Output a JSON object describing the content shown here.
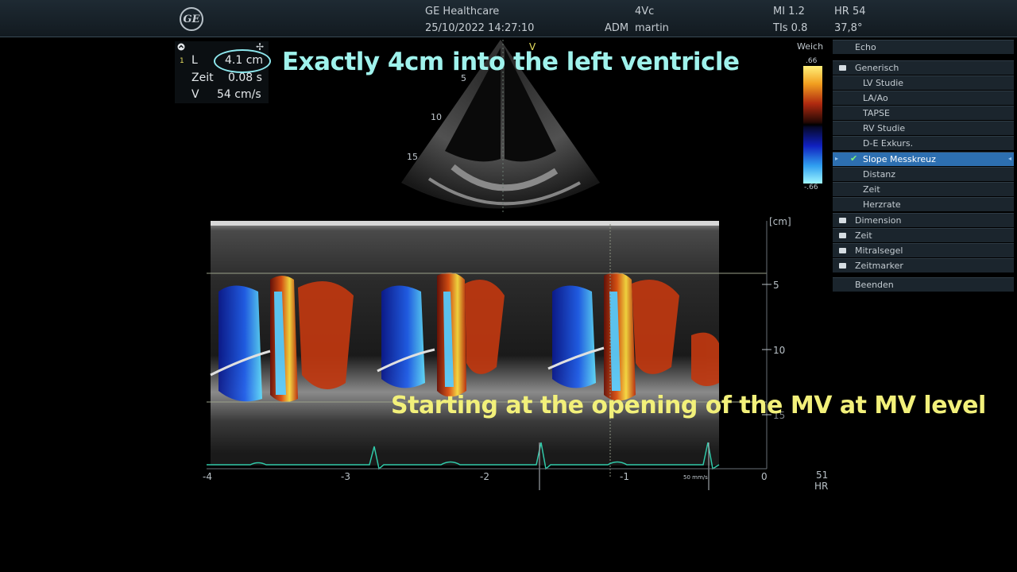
{
  "header": {
    "logo": "GE",
    "vendor": "GE Healthcare",
    "datetime": "25/10/2022 14:27:10",
    "probe": "4Vc",
    "user_prefix": "ADM",
    "user": "martin",
    "mi": "MI 1.2",
    "tis": "TIs 0.8",
    "hr": "HR 54",
    "temp": "37,8°"
  },
  "measurement": {
    "index": "1",
    "rows": [
      {
        "label": "L",
        "value": "4.1 cm"
      },
      {
        "label": "Zeit",
        "value": "0.08 s"
      },
      {
        "label": "V",
        "value": "54 cm/s"
      }
    ]
  },
  "annotations": {
    "top": "Exactly 4cm into the left ventricle",
    "bottom": "Starting at the opening of the MV at MV level"
  },
  "sector": {
    "marker": "V",
    "depth_labels": [
      "5",
      "10",
      "15"
    ]
  },
  "colorbar": {
    "title": "Weich",
    "top": ".66",
    "bottom": "-.66",
    "colors": [
      "#fff07a",
      "#b02a10",
      "#1020c0",
      "#9ff6ff"
    ]
  },
  "mmode": {
    "depth_unit": "[cm]",
    "depth_ticks": [
      "5",
      "10",
      "15"
    ],
    "time_ticks": [
      "-4",
      "-3",
      "-2",
      "-1",
      "0"
    ],
    "sweep_speed": "50 mm/s",
    "hr_value": "51",
    "hr_label": "HR"
  },
  "menu": {
    "items": [
      {
        "label": "Echo",
        "type": "header"
      },
      {
        "label": "Generisch",
        "type": "folder-open"
      },
      {
        "label": "LV Studie",
        "type": "child"
      },
      {
        "label": "LA/Ao",
        "type": "child"
      },
      {
        "label": "TAPSE",
        "type": "child"
      },
      {
        "label": "RV Studie",
        "type": "child"
      },
      {
        "label": "D-E Exkurs.",
        "type": "child"
      },
      {
        "label": "Slope Messkreuz",
        "type": "child-selected"
      },
      {
        "label": "Distanz",
        "type": "child"
      },
      {
        "label": "Zeit",
        "type": "child"
      },
      {
        "label": "Herzrate",
        "type": "child"
      },
      {
        "label": "Dimension",
        "type": "folder"
      },
      {
        "label": "Zeit",
        "type": "folder"
      },
      {
        "label": "Mitralsegel",
        "type": "folder"
      },
      {
        "label": "Zeitmarker",
        "type": "folder"
      },
      {
        "label": "Beenden",
        "type": "action"
      }
    ]
  }
}
